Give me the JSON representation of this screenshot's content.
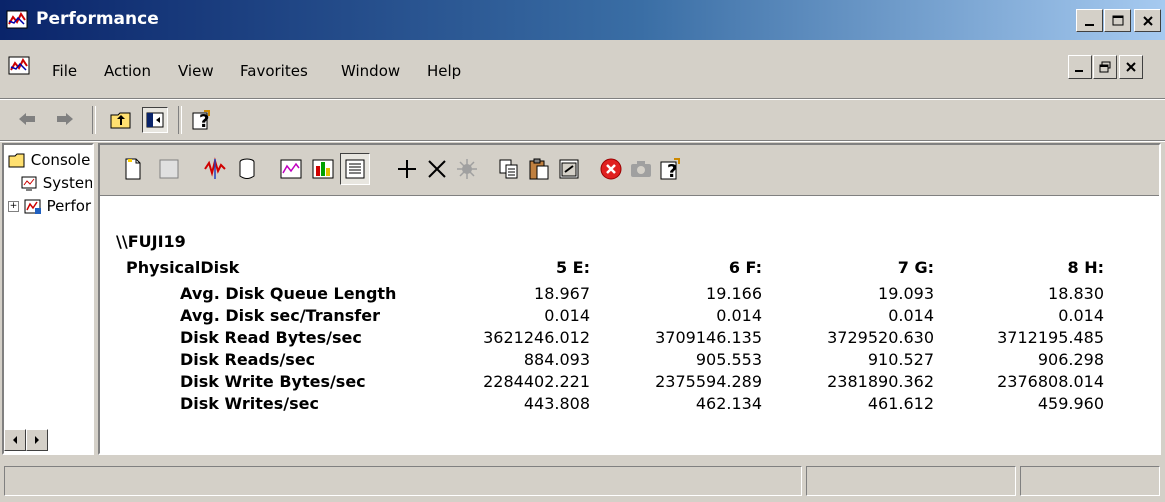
{
  "window": {
    "title": "Performance"
  },
  "menu": {
    "items": [
      "File",
      "Action",
      "View",
      "Favorites",
      "Window",
      "Help"
    ]
  },
  "tree": {
    "items": [
      {
        "label": "Console Root"
      },
      {
        "label": "System Monitor"
      },
      {
        "label": "Performance Logs and Alerts"
      }
    ]
  },
  "report": {
    "machine": "\\\\FUJI19",
    "object": "PhysicalDisk",
    "instances": [
      "5 E:",
      "6 F:",
      "7 G:",
      "8 H:"
    ],
    "counters": [
      {
        "name": "Avg. Disk Queue Length",
        "values": [
          "18.967",
          "19.166",
          "19.093",
          "18.830"
        ]
      },
      {
        "name": "Avg. Disk sec/Transfer",
        "values": [
          "0.014",
          "0.014",
          "0.014",
          "0.014"
        ]
      },
      {
        "name": "Disk Read Bytes/sec",
        "values": [
          "3621246.012",
          "3709146.135",
          "3729520.630",
          "3712195.485"
        ]
      },
      {
        "name": "Disk Reads/sec",
        "values": [
          "884.093",
          "905.553",
          "910.527",
          "906.298"
        ]
      },
      {
        "name": "Disk Write Bytes/sec",
        "values": [
          "2284402.221",
          "2375594.289",
          "2381890.362",
          "2376808.014"
        ]
      },
      {
        "name": "Disk Writes/sec",
        "values": [
          "443.808",
          "462.134",
          "461.612",
          "459.960"
        ]
      }
    ]
  },
  "colors": {
    "titlebar_start": "#0a246a",
    "titlebar_end": "#a6caf0",
    "face": "#d4d0c8",
    "stop_red": "#e02020"
  }
}
